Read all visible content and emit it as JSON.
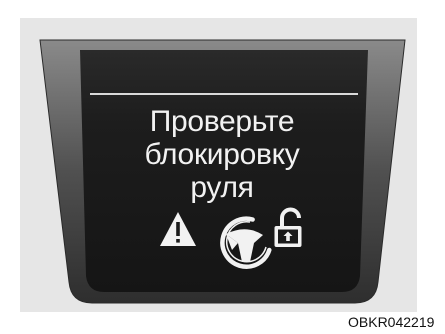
{
  "display": {
    "message_lines": [
      "Проверьте",
      "блокировку",
      "руля"
    ],
    "icons": [
      "warning-triangle-icon",
      "steering-wheel-icon",
      "padlock-icon"
    ]
  },
  "caption": "OBKR042219",
  "colors": {
    "screen": "#1c1c1c",
    "bezel": "#4d4d4d",
    "text": "#f2f2f2",
    "divider": "#d9d9d9",
    "backdrop": "#e6e6e6"
  }
}
